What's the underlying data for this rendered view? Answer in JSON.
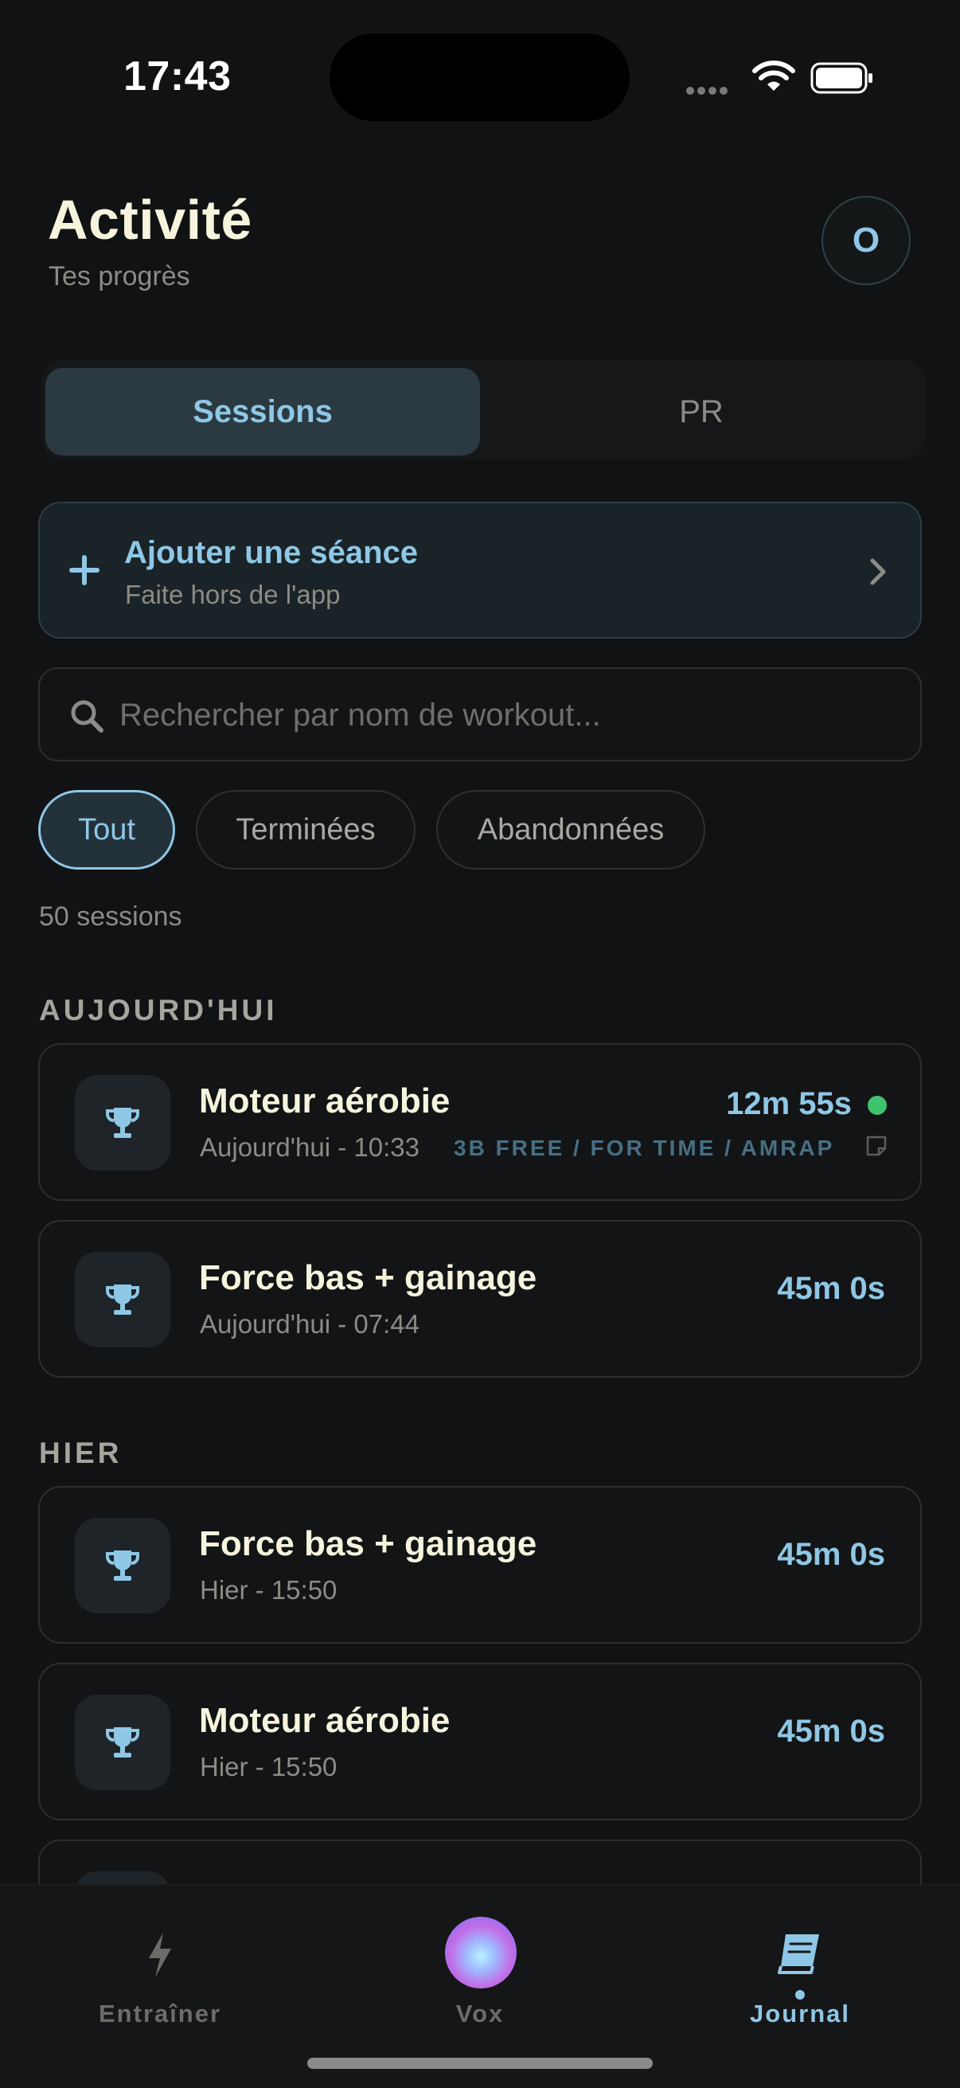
{
  "status_bar": {
    "time": "17:43"
  },
  "header": {
    "title": "Activité",
    "subtitle": "Tes progrès",
    "avatar_initial": "O"
  },
  "tabs": [
    {
      "label": "Sessions",
      "active": true
    },
    {
      "label": "PR",
      "active": false
    }
  ],
  "add_session": {
    "title": "Ajouter une séance",
    "subtitle": "Faite hors de l'app"
  },
  "search": {
    "placeholder": "Rechercher par nom de workout...",
    "value": ""
  },
  "filters": [
    {
      "label": "Tout",
      "active": true
    },
    {
      "label": "Terminées",
      "active": false
    },
    {
      "label": "Abandonnées",
      "active": false
    }
  ],
  "session_count": "50 sessions",
  "sections": [
    {
      "label": "AUJOURD'HUI",
      "sessions": [
        {
          "name": "Moteur aérobie",
          "time": "Aujourd'hui - 10:33",
          "tags": "3B FREE / FOR TIME / AMRAP",
          "duration": "12m 55s",
          "status": "completed",
          "has_note": true
        },
        {
          "name": "Force bas + gainage",
          "time": "Aujourd'hui - 07:44",
          "duration": "45m 0s"
        }
      ]
    },
    {
      "label": "HIER",
      "sessions": [
        {
          "name": "Force bas + gainage",
          "time": "Hier - 15:50",
          "duration": "45m 0s"
        },
        {
          "name": "Moteur aérobie",
          "time": "Hier - 15:50",
          "duration": "45m 0s"
        }
      ]
    }
  ],
  "bottom_nav": [
    {
      "label": "Entraîner",
      "icon": "bolt-icon"
    },
    {
      "label": "Vox",
      "icon": "vox-orb-icon"
    },
    {
      "label": "Journal",
      "icon": "book-icon",
      "active": true
    }
  ],
  "colors": {
    "accent": "#8fc7e6",
    "background": "#111213",
    "success": "#3ec46d"
  }
}
